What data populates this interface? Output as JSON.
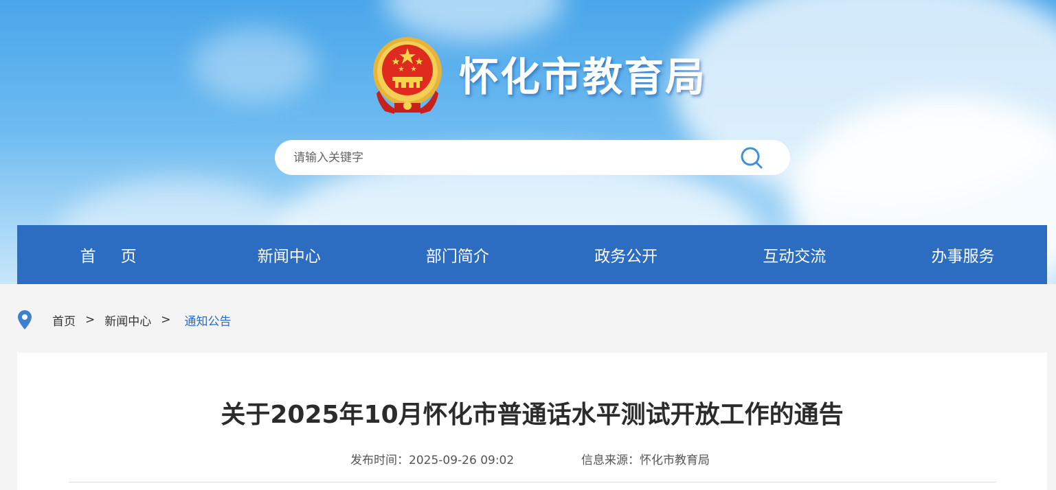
{
  "header": {
    "site_title": "怀化市教育局",
    "emblem_icon": "national-emblem-icon"
  },
  "search": {
    "placeholder": "请输入关键字",
    "icon": "search-icon"
  },
  "nav": {
    "items": [
      {
        "label": "首页"
      },
      {
        "label": "新闻中心"
      },
      {
        "label": "部门简介"
      },
      {
        "label": "政务公开"
      },
      {
        "label": "互动交流"
      },
      {
        "label": "办事服务"
      }
    ]
  },
  "breadcrumb": {
    "icon": "location-pin-icon",
    "items": [
      "首页",
      "新闻中心"
    ],
    "current": "通知公告",
    "separator": ">"
  },
  "article": {
    "title": "关于2025年10月怀化市普通话水平测试开放工作的通告",
    "publish_label": "发布时间：2025-09-26 09:02",
    "source_label": "信息来源：怀化市教育局"
  },
  "colors": {
    "nav_bg": "#2c6cc1",
    "accent": "#2c6cc1",
    "page_bg": "#f4f4f4"
  }
}
